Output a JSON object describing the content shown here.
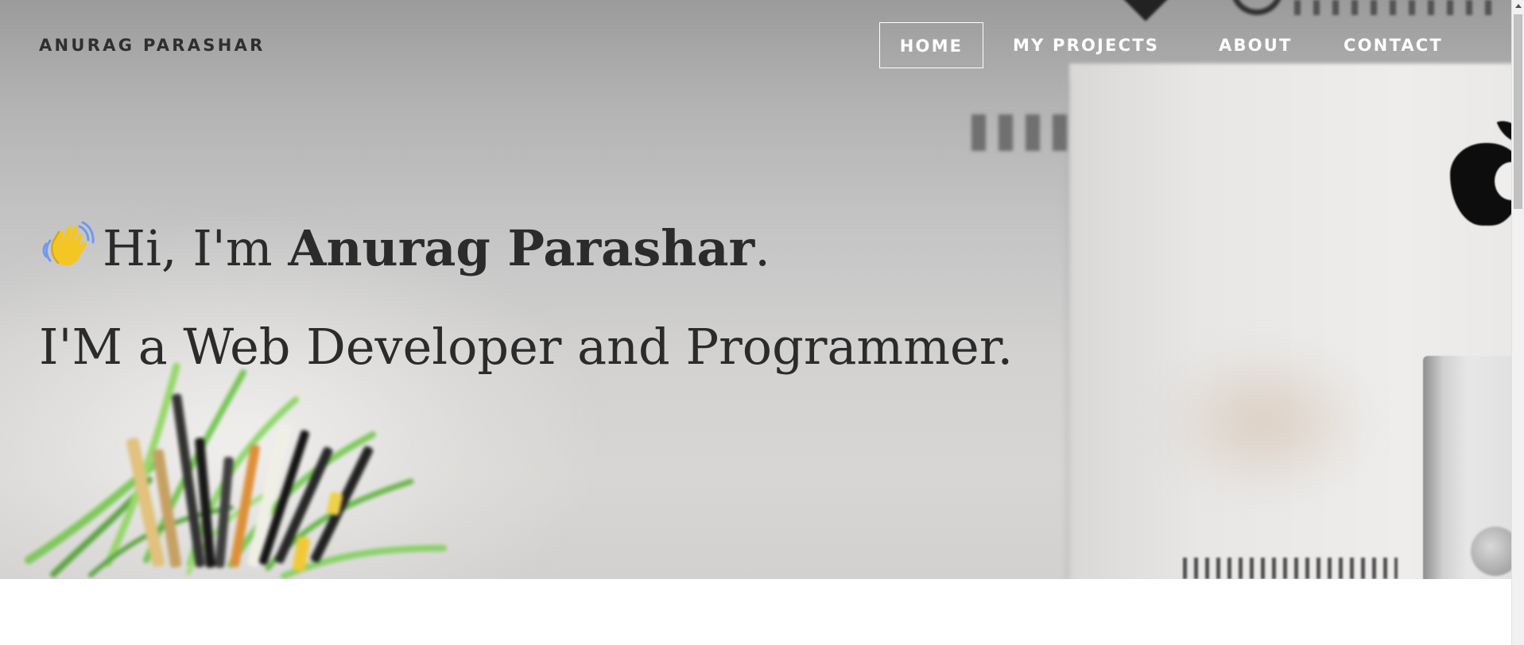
{
  "site": {
    "brand_name": "ANURAG PARASHAR"
  },
  "nav": {
    "items": [
      {
        "label": "HOME",
        "active": true
      },
      {
        "label": "MY PROJECTS",
        "active": false
      },
      {
        "label": "ABOUT",
        "active": false
      },
      {
        "label": "CONTACT",
        "active": false
      }
    ]
  },
  "hero": {
    "greeting_prefix": "Hi, I'm ",
    "name": "Anurag Parashar",
    "greeting_suffix": ".",
    "subtitle": "I'M a Web Developer and Programmer.",
    "wave_icon": "waving-hand-icon"
  },
  "theme": {
    "nav_text_color": "#ffffff",
    "brand_text_color": "#2f2f2f",
    "hero_text_color": "#2b2b2b",
    "page_background": "#ffffff",
    "hero_background": "#c8c7c6"
  },
  "scrollbar": {
    "icon": "scroll-up-arrow-icon"
  }
}
